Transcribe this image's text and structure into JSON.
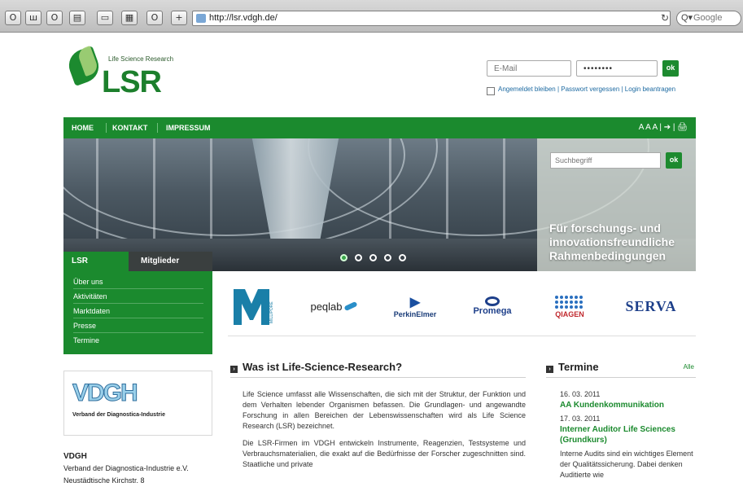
{
  "browser": {
    "toolbar_buttons": [
      "O",
      "ш",
      "O",
      "▤",
      "▭",
      "▦",
      "O",
      "+"
    ],
    "url": "http://lsr.vdgh.de/",
    "reload_icon": "↻",
    "search_placeholder": "Google",
    "search_prefix": "Q▾"
  },
  "header": {
    "logo_sub": "Life Science Research",
    "logo_text": "LSR",
    "login": {
      "email_placeholder": "E-Mail",
      "password_value": "••••••••",
      "ok_label": "ok",
      "links": "Angemeldet bleiben | Passwort vergessen | Login beantragen"
    }
  },
  "nav": {
    "items": [
      "HOME",
      "KONTAKT",
      "IMPRESSUM"
    ],
    "tools": "A A A  |  ➔  |  🖨"
  },
  "hero": {
    "search_placeholder": "Suchbegriff",
    "ok_label": "ok",
    "claim": "Für forschungs- und innovationsfreundliche Rahmenbedingungen",
    "dots_count": 5,
    "active_dot": 0
  },
  "left": {
    "tab_active": "LSR",
    "tab_other": "Mitglieder",
    "menu": [
      "Über uns",
      "Aktivitäten",
      "Marktdaten",
      "Presse",
      "Termine"
    ],
    "vdgh_logo_text": "VDGH",
    "vdgh_logo_sub": "Verband der Diagnostica-Industrie",
    "address": {
      "name": "VDGH",
      "line1": "Verband der Diagnostica-Industrie e.V.",
      "line2": "Neustädtische Kirchstr. 8"
    }
  },
  "partners": {
    "millipore": "MILLIPORE",
    "peqlab": "peqlab",
    "perkinelmer": "PerkinElmer",
    "promega": "Promega",
    "qiagen": "QIAGEN",
    "serva": "SERVA"
  },
  "article": {
    "title": "Was ist Life-Science-Research?",
    "p1": "Life Science umfasst alle Wissenschaften, die sich mit der Struktur, der Funktion und dem Verhalten lebender Organismen befassen. Die Grundlagen- und angewandte Forschung in allen Bereichen der Lebenswissenschaften wird als Life Science Research (LSR) bezeichnet.",
    "p2": "Die LSR-Firmen im VDGH entwickeln Instrumente, Reagenzien, Testsysteme und Verbrauchsmaterialien, die exakt auf die Bedürfnisse der Forscher zugeschnitten sind. Staatliche und private"
  },
  "termine": {
    "title": "Termine",
    "all_label": "Alle",
    "events": [
      {
        "date": "16. 03. 2011",
        "title": "AA Kundenkommunikation",
        "desc": ""
      },
      {
        "date": "17. 03. 2011",
        "title": "Interner Auditor Life Sciences (Grundkurs)",
        "desc": "Interne Audits sind ein wichtiges Element der Qualitätssicherung. Dabei denken Auditierte wie"
      }
    ]
  }
}
